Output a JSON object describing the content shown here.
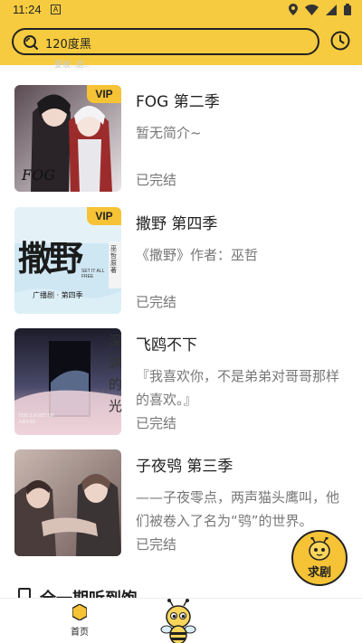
{
  "status_bar": {
    "time": "11:24",
    "notification_letter": "A"
  },
  "search": {
    "query": "120度黑"
  },
  "header_peek": "要被..追..",
  "books": [
    {
      "title": "FOG 第二季",
      "description": "暂无简介~",
      "status": "已完结",
      "vip": "VIP",
      "cover_text": "FOG"
    },
    {
      "title": "撒野 第四季",
      "description": "《撒野》作者：巫哲",
      "status": "已完结",
      "vip": "VIP",
      "cover_text": "撒野",
      "cover_sub": "广播剧 · 第四季",
      "cover_side": "巫哲原著",
      "cover_en": "SET IT ALL FREE"
    },
    {
      "title": "飞鸥不下",
      "description": "『我喜欢你，不是弟弟对哥哥那样的喜欢。』",
      "status": "已完结",
      "cover_vertical": "深渊的光",
      "cover_en": "THE LIGHT OF ABYSS"
    },
    {
      "title": "子夜鸮 第三季",
      "description": "——子夜零点，两声猫头鹰叫，他们被卷入了名为“鸮”的世界。",
      "status": "已完结"
    }
  ],
  "section": {
    "title": "全一期听到饱"
  },
  "request_button": {
    "label": "求剧"
  },
  "bottom_nav": {
    "home_label": "首页"
  },
  "colors": {
    "accent": "#f6cb3f",
    "vip": "#f6c336",
    "text_primary": "#222222",
    "text_secondary": "#777777"
  }
}
